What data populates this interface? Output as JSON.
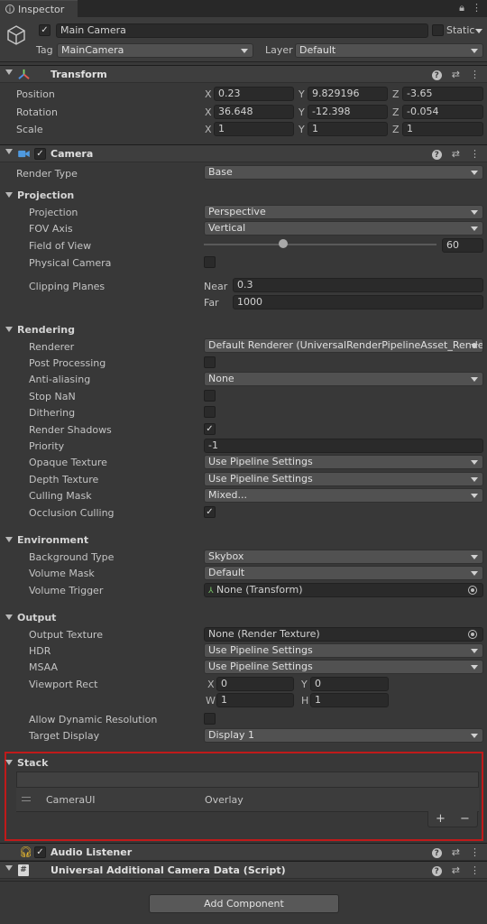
{
  "tab": {
    "title": "Inspector",
    "lock_icon": "lock-icon",
    "menu_icon": "kebab-menu-icon"
  },
  "object": {
    "name": "Main Camera",
    "active": true,
    "static_label": "Static",
    "tag_label": "Tag",
    "tag_value": "MainCamera",
    "layer_label": "Layer",
    "layer_value": "Default"
  },
  "transform": {
    "title": "Transform",
    "position_label": "Position",
    "rotation_label": "Rotation",
    "scale_label": "Scale",
    "position": {
      "x": "0.23",
      "y": "9.829196",
      "z": "-3.65"
    },
    "rotation": {
      "x": "36.648",
      "y": "-12.398",
      "z": "-0.054"
    },
    "scale": {
      "x": "1",
      "y": "1",
      "z": "1"
    },
    "axis_x": "X",
    "axis_y": "Y",
    "axis_z": "Z"
  },
  "camera": {
    "title": "Camera",
    "enabled": true,
    "render_type_label": "Render Type",
    "render_type": "Base",
    "projection_section": "Projection",
    "projection_label": "Projection",
    "projection": "Perspective",
    "fov_axis_label": "FOV Axis",
    "fov_axis": "Vertical",
    "fov_label": "Field of View",
    "fov_value": "60",
    "fov_slider_fraction": 0.33,
    "physical_camera_label": "Physical Camera",
    "physical_camera": false,
    "clipping_label": "Clipping Planes",
    "near_label": "Near",
    "near": "0.3",
    "far_label": "Far",
    "far": "1000",
    "rendering_section": "Rendering",
    "renderer_label": "Renderer",
    "renderer": "Default Renderer (UniversalRenderPipelineAsset_Render",
    "post_processing_label": "Post Processing",
    "post_processing": false,
    "anti_aliasing_label": "Anti-aliasing",
    "anti_aliasing": "None",
    "stop_nan_label": "Stop NaN",
    "stop_nan": false,
    "dithering_label": "Dithering",
    "dithering": false,
    "render_shadows_label": "Render Shadows",
    "render_shadows": true,
    "priority_label": "Priority",
    "priority": "-1",
    "opaque_texture_label": "Opaque Texture",
    "opaque_texture": "Use Pipeline Settings",
    "depth_texture_label": "Depth Texture",
    "depth_texture": "Use Pipeline Settings",
    "culling_mask_label": "Culling Mask",
    "culling_mask": "Mixed...",
    "occlusion_culling_label": "Occlusion Culling",
    "occlusion_culling": true,
    "environment_section": "Environment",
    "background_type_label": "Background Type",
    "background_type": "Skybox",
    "volume_mask_label": "Volume Mask",
    "volume_mask": "Default",
    "volume_trigger_label": "Volume Trigger",
    "volume_trigger": "None (Transform)",
    "output_section": "Output",
    "output_texture_label": "Output Texture",
    "output_texture": "None (Render Texture)",
    "hdr_label": "HDR",
    "hdr": "Use Pipeline Settings",
    "msaa_label": "MSAA",
    "msaa": "Use Pipeline Settings",
    "viewport_label": "Viewport Rect",
    "viewport": {
      "x": "0",
      "y": "0",
      "w": "1",
      "h": "1"
    },
    "viewport_axis_x": "X",
    "viewport_axis_y": "Y",
    "viewport_axis_w": "W",
    "viewport_axis_h": "H",
    "dynamic_res_label": "Allow Dynamic Resolution",
    "dynamic_res": false,
    "target_display_label": "Target Display",
    "target_display": "Display 1",
    "stack_section": "Stack",
    "stack_items": [
      {
        "name": "CameraUI",
        "type": "Overlay"
      }
    ],
    "stack_add": "+",
    "stack_remove": "−"
  },
  "audio_listener": {
    "title": "Audio Listener",
    "enabled": true
  },
  "additional_data": {
    "title": "Universal Additional Camera Data (Script)"
  },
  "add_component_label": "Add Component",
  "colors": {
    "highlight_border": "#c01a1a",
    "background": "#383838"
  }
}
